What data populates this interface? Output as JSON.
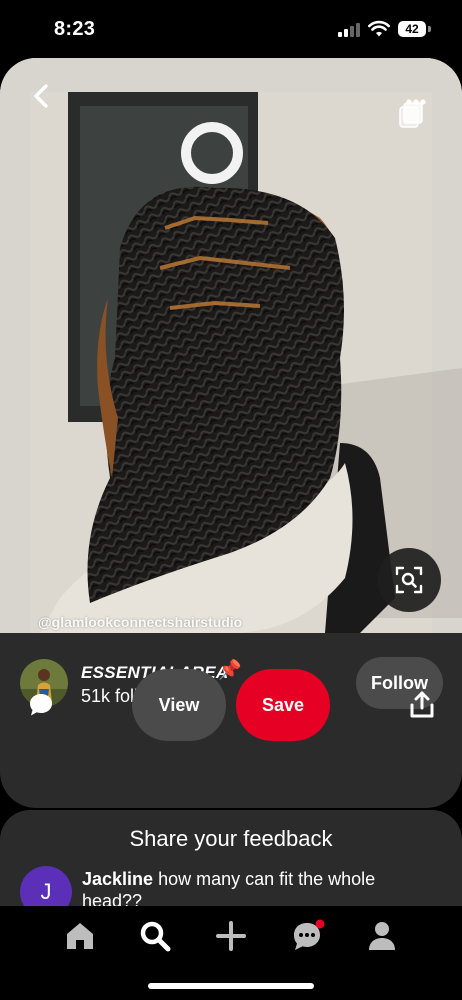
{
  "status_bar": {
    "time": "8:23",
    "battery": "42"
  },
  "pin": {
    "watermark": "@glamlookconnectshairstudio",
    "back_icon": "chevron-left-icon",
    "more_icon": "stack-icon",
    "lens_icon": "visual-search-icon"
  },
  "creator": {
    "name": "ESSENTIALAREA",
    "emoji": "📌",
    "followers": "51k followers",
    "follow_label": "Follow"
  },
  "actions": {
    "comment_icon": "comment-icon",
    "view_label": "View",
    "save_label": "Save",
    "share_icon": "share-icon"
  },
  "feedback": {
    "title": "Share your feedback",
    "comment": {
      "avatar_letter": "J",
      "author": "Jackline",
      "text": "how many can fit the whole head??"
    }
  },
  "tab_bar": {
    "items": [
      "home-icon",
      "search-icon",
      "create-icon",
      "messages-icon",
      "profile-icon"
    ],
    "active": "search-icon"
  },
  "colors": {
    "save": "#e60023",
    "card_bg": "#2b2b2b",
    "button_bg": "#4b4b4b",
    "avatar_j": "#5b2fb8"
  }
}
